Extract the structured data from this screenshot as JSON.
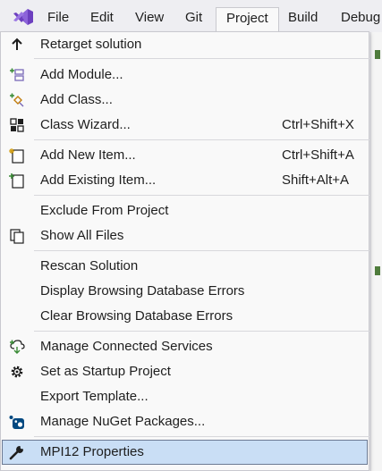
{
  "menubar": {
    "items": [
      "File",
      "Edit",
      "View",
      "Git",
      "Project",
      "Build",
      "Debug"
    ],
    "active": "Project"
  },
  "menu": {
    "items": [
      {
        "label": "Retarget solution",
        "shortcut": "",
        "icon": "arrow-up-icon"
      },
      {
        "label": "Add Module...",
        "shortcut": "",
        "icon": "add-module-icon"
      },
      {
        "label": "Add Class...",
        "shortcut": "",
        "icon": "add-class-icon"
      },
      {
        "label": "Class Wizard...",
        "shortcut": "Ctrl+Shift+X",
        "icon": "class-wizard-icon"
      },
      {
        "label": "Add New Item...",
        "shortcut": "Ctrl+Shift+A",
        "icon": "new-item-icon"
      },
      {
        "label": "Add Existing Item...",
        "shortcut": "Shift+Alt+A",
        "icon": "existing-item-icon"
      },
      {
        "label": "Exclude From Project",
        "shortcut": "",
        "icon": ""
      },
      {
        "label": "Show All Files",
        "shortcut": "",
        "icon": "show-all-files-icon"
      },
      {
        "label": "Rescan Solution",
        "shortcut": "",
        "icon": ""
      },
      {
        "label": "Display Browsing Database Errors",
        "shortcut": "",
        "icon": ""
      },
      {
        "label": "Clear Browsing Database Errors",
        "shortcut": "",
        "icon": ""
      },
      {
        "label": "Manage Connected Services",
        "shortcut": "",
        "icon": "connected-services-icon"
      },
      {
        "label": "Set as Startup Project",
        "shortcut": "",
        "icon": "gear-icon"
      },
      {
        "label": "Export Template...",
        "shortcut": "",
        "icon": ""
      },
      {
        "label": "Manage NuGet Packages...",
        "shortcut": "",
        "icon": "nuget-icon"
      },
      {
        "label": "MPI12 Properties",
        "shortcut": "",
        "icon": "wrench-icon"
      }
    ]
  },
  "colors": {
    "menu_background": "#f9f9f9",
    "highlight": "#c9def5",
    "highlight_border": "#6c7a93",
    "accent": "#68217a"
  }
}
